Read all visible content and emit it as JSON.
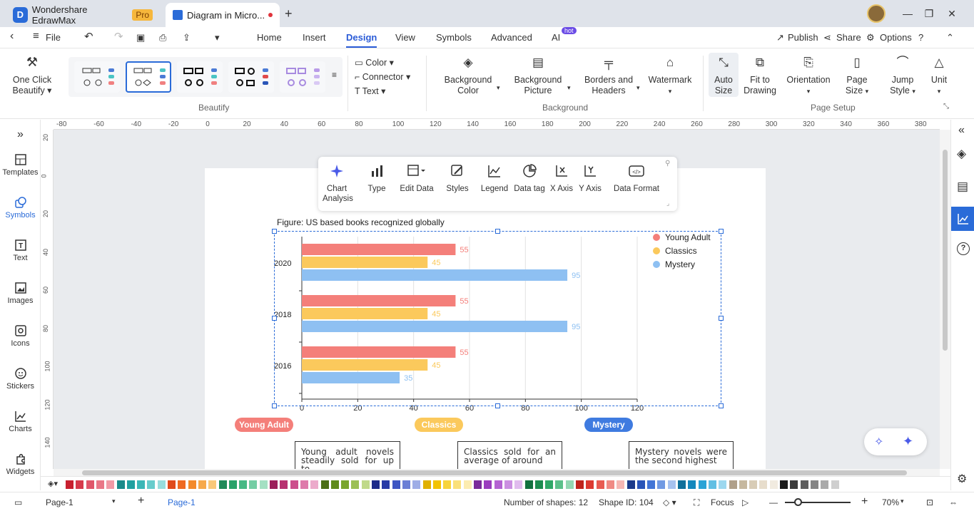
{
  "titlebar": {
    "app_tab": "Wondershare EdrawMax",
    "pro_badge": "Pro",
    "doc_tab": "Diagram in Micro...",
    "new_tab": "+"
  },
  "menubar": {
    "file": "File",
    "tabs": [
      "Home",
      "Insert",
      "Design",
      "View",
      "Symbols",
      "Advanced",
      "AI"
    ],
    "ai_badge": "hot",
    "publish": "Publish",
    "share": "Share",
    "options": "Options"
  },
  "ribbon": {
    "one_click_beautify": [
      "One Click",
      "Beautify"
    ],
    "beautify_label": "Beautify",
    "color": "Color",
    "connector": "Connector",
    "text": "Text",
    "background_color": [
      "Background",
      "Color"
    ],
    "background_picture": [
      "Background",
      "Picture"
    ],
    "borders_headers": [
      "Borders and",
      "Headers"
    ],
    "watermark": "Watermark",
    "background_label": "Background",
    "auto_size": [
      "Auto",
      "Size"
    ],
    "fit_to_drawing": [
      "Fit to",
      "Drawing"
    ],
    "orientation": "Orientation",
    "page_size": [
      "Page",
      "Size"
    ],
    "jump_style": [
      "Jump",
      "Style"
    ],
    "unit": "Unit",
    "page_setup_label": "Page Setup"
  },
  "leftbar": [
    "Templates",
    "Symbols",
    "Text",
    "Images",
    "Icons",
    "Stickers",
    "Charts",
    "Widgets"
  ],
  "ruler_top": [
    "-80",
    "-60",
    "-40",
    "-20",
    "0",
    "20",
    "40",
    "60",
    "80",
    "100",
    "120",
    "140",
    "160",
    "180",
    "200",
    "220",
    "240",
    "260",
    "280",
    "300",
    "320",
    "340",
    "360",
    "380"
  ],
  "ruler_left": [
    "20",
    "0",
    "20",
    "40",
    "60",
    "80",
    "100",
    "120",
    "140"
  ],
  "chart_toolbar": {
    "items": [
      "Chart Analysis",
      "Type",
      "Edit Data",
      "Styles",
      "Legend",
      "Data tag",
      "X Axis",
      "Y Axis",
      "Data Format"
    ]
  },
  "chart_data": {
    "type": "bar",
    "orientation": "horizontal",
    "title": "Figure: US based books recognized globally",
    "categories": [
      "2020",
      "2018",
      "2016"
    ],
    "series": [
      {
        "name": "Young Adult",
        "values": [
          55,
          55,
          55
        ],
        "color": "#f47f7a"
      },
      {
        "name": "Classics",
        "values": [
          45,
          45,
          45
        ],
        "color": "#fbc95c"
      },
      {
        "name": "Mystery",
        "values": [
          95,
          95,
          35
        ],
        "color": "#8ec0f2"
      }
    ],
    "xlim": [
      0,
      120
    ],
    "xticks": [
      "0",
      "20",
      "40",
      "60",
      "80",
      "100",
      "120"
    ],
    "legend": "top-right",
    "grid": true
  },
  "pills": [
    {
      "label": "Young Adult",
      "color": "#f47f7a"
    },
    {
      "label": "Classics",
      "color": "#fbc95c"
    },
    {
      "label": "Mystery",
      "color": "#3f7be0"
    }
  ],
  "notes": [
    "Young adult novels steadily sold for up to",
    "Classics sold for an average of around",
    "Mystery novels were the second highest"
  ],
  "statusbar": {
    "page_selector": "Page-1",
    "add_page": "+",
    "active_page": "Page-1",
    "shapes": "Number of shapes: 12",
    "shape_id": "Shape ID: 104",
    "focus": "Focus",
    "zoom": "70%"
  },
  "palette": [
    "#c8202f",
    "#d63a4b",
    "#e0566a",
    "#e97787",
    "#f19aa6",
    "#1a8a8a",
    "#21a0a0",
    "#3bb7b7",
    "#67cccc",
    "#98dddd",
    "#e04a1b",
    "#ef6a22",
    "#f38a2b",
    "#f6a94b",
    "#f9c879",
    "#1f8a59",
    "#29a26a",
    "#47b985",
    "#74cda4",
    "#a4e0c3",
    "#9c1e5a",
    "#b73170",
    "#cc4f8c",
    "#de7bab",
    "#ecaacb",
    "#4b6e15",
    "#5f8a1c",
    "#7aa52f",
    "#9cc056",
    "#c0d98a",
    "#1d2b8a",
    "#283ba6",
    "#3f57c3",
    "#6b7fd6",
    "#9eade6",
    "#e0b100",
    "#f2c300",
    "#f7d43c",
    "#fae07a",
    "#fcecb0",
    "#7a2a9a",
    "#9a3dbe",
    "#b463d2",
    "#cb8fe1",
    "#e0bbee",
    "#12713f",
    "#1b8c4f",
    "#2fa867",
    "#5cc08a",
    "#94d7b2",
    "#c0241c",
    "#dc3a31",
    "#e85b52",
    "#f08a84",
    "#f6b7b3",
    "#1b3a8a",
    "#2a55b8",
    "#4375d6",
    "#719ae3",
    "#a7c2ef",
    "#0f6f9a",
    "#1488bd",
    "#2aa3d6",
    "#61bfe3",
    "#9dd8ef",
    "#b0a08a",
    "#c6b89f",
    "#d8ccb6",
    "#e7ddcc",
    "#f1ebe0",
    "#1a1a1a",
    "#3c3c3c",
    "#5e5e5e",
    "#858585",
    "#aaaaaa",
    "#cfcfcf"
  ]
}
